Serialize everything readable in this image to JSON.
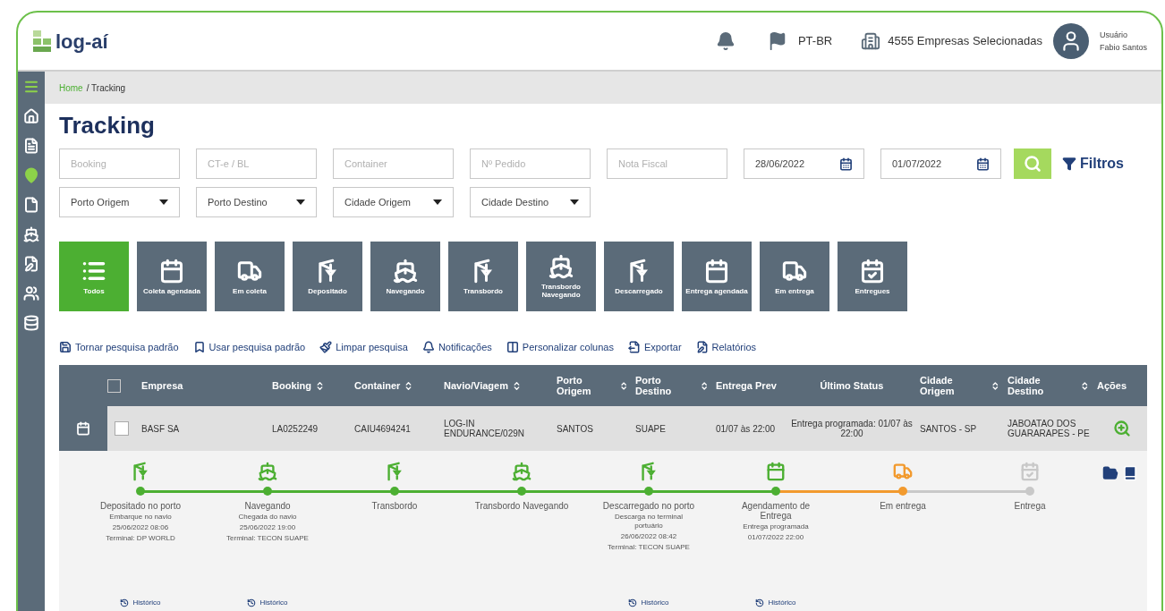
{
  "header": {
    "logo": "log-aí",
    "language": "PT-BR",
    "companies": "4555 Empresas Selecionadas",
    "user_label": "Usuário",
    "user_name": "Fabio Santos"
  },
  "sidebar": {
    "items": [
      {
        "kind": "home",
        "selected": false
      },
      {
        "kind": "list",
        "selected": false
      },
      {
        "kind": "pin",
        "selected": true
      },
      {
        "kind": "file",
        "selected": false
      },
      {
        "kind": "ship",
        "selected": false
      },
      {
        "kind": "edit",
        "selected": false
      },
      {
        "kind": "users",
        "selected": false
      },
      {
        "kind": "database",
        "selected": false
      }
    ]
  },
  "breadcrumb": {
    "home": "Home",
    "current": "/ Tracking"
  },
  "title": "Tracking",
  "filters": {
    "text_fields": [
      {
        "placeholder": "Booking"
      },
      {
        "placeholder": "CT-e / BL"
      },
      {
        "placeholder": "Container"
      },
      {
        "placeholder": "Nº Pedido"
      },
      {
        "placeholder": "Nota Fiscal"
      }
    ],
    "dates": [
      {
        "value": "28/06/2022"
      },
      {
        "value": "01/07/2022"
      }
    ],
    "filter_label": "Filtros",
    "dropdowns": [
      {
        "label": "Porto Origem"
      },
      {
        "label": "Porto Destino"
      },
      {
        "label": "Cidade Origem"
      },
      {
        "label": "Cidade Destino"
      }
    ]
  },
  "status_cards": [
    {
      "label": "Todos",
      "kind": "list",
      "selected": true
    },
    {
      "label": "Coleta agendada",
      "kind": "calendar",
      "selected": false
    },
    {
      "label": "Em coleta",
      "kind": "truck",
      "selected": false
    },
    {
      "label": "Depositado",
      "kind": "crane",
      "selected": false
    },
    {
      "label": "Navegando",
      "kind": "ship",
      "selected": false
    },
    {
      "label": "Transbordo",
      "kind": "crane",
      "selected": false
    },
    {
      "label": "Transbordo Navegando",
      "kind": "ship",
      "selected": false
    },
    {
      "label": "Descarregado",
      "kind": "crane",
      "selected": false
    },
    {
      "label": "Entrega agendada",
      "kind": "calendar",
      "selected": false
    },
    {
      "label": "Em entrega",
      "kind": "truck",
      "selected": false
    },
    {
      "label": "Entregues",
      "kind": "calendar-check",
      "selected": false
    }
  ],
  "actions": [
    {
      "label": "Tornar pesquisa padrão",
      "kind": "save"
    },
    {
      "label": "Usar pesquisa padrão",
      "kind": "bookmark"
    },
    {
      "label": "Limpar pesquisa",
      "kind": "brush"
    },
    {
      "label": "Notificações",
      "kind": "bell"
    },
    {
      "label": "Personalizar colunas",
      "kind": "columns"
    },
    {
      "label": "Exportar",
      "kind": "export"
    },
    {
      "label": "Relatórios",
      "kind": "report"
    }
  ],
  "table": {
    "header_checked": false,
    "columns": [
      {
        "label": "Empresa",
        "sortable": false
      },
      {
        "label": "Booking",
        "sortable": true
      },
      {
        "label": "Container",
        "sortable": true
      },
      {
        "label": "Navio/Viagem",
        "sortable": true
      },
      {
        "label": "Porto Origem",
        "sortable": true
      },
      {
        "label": "Porto Destino",
        "sortable": true
      },
      {
        "label": "Entrega Prev",
        "sortable": false
      },
      {
        "label": "Último Status",
        "sortable": false
      },
      {
        "label": "Cidade Origem",
        "sortable": true
      },
      {
        "label": "Cidade Destino",
        "sortable": true
      },
      {
        "label": "Ações",
        "sortable": false
      }
    ],
    "rows": [
      {
        "checked": false,
        "cells": [
          "BASF SA",
          "LA0252249",
          "CAIU4694241",
          "LOG-IN ENDURANCE/029N",
          "SANTOS",
          "SUAPE",
          "01/07 às 22:00",
          "Entrega programada: 01/07 às 22:00",
          "SANTOS - SP",
          "JABOATAO DOS GUARARAPES - PE"
        ]
      }
    ]
  },
  "timeline": [
    {
      "title": "Depositado no porto",
      "kind": "crane",
      "done": true,
      "current": false,
      "details": [
        "Embarque no navio",
        "25/06/2022 08:06",
        "Terminal: DP WORLD"
      ],
      "history": "Histórico"
    },
    {
      "title": "Navegando",
      "kind": "ship",
      "done": true,
      "current": false,
      "details": [
        "Chegada do navio",
        "25/06/2022 19:00",
        "Terminal: TECON SUAPE"
      ],
      "history": "Histórico"
    },
    {
      "title": "Transbordo",
      "kind": "crane",
      "done": true,
      "current": false
    },
    {
      "title": "Transbordo Navegando",
      "kind": "ship",
      "done": true,
      "current": false
    },
    {
      "title": "Descarregado no porto",
      "kind": "crane",
      "done": true,
      "current": false,
      "details": [
        "Descarga no terminal portuário",
        "26/06/2022 08:42",
        "Terminal: TECON SUAPE"
      ],
      "history": "Histórico"
    },
    {
      "title": "Agendamento de Entrega",
      "kind": "calendar",
      "done": true,
      "current": false,
      "details": [
        "Entrega programada",
        "01/07/2022 22:00"
      ],
      "history": "Histórico"
    },
    {
      "title": "Em entrega",
      "kind": "truck",
      "done": false,
      "current": true
    },
    {
      "title": "Entrega",
      "kind": "calendar-check",
      "done": false,
      "current": false
    }
  ]
}
